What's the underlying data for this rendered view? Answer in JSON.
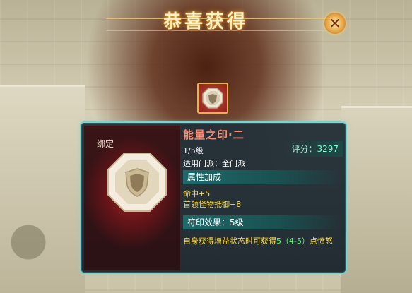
{
  "header": {
    "title": "恭喜获得",
    "close_icon": "close-x-icon"
  },
  "reward": {
    "icon": "octagon-shield-gem-icon"
  },
  "item": {
    "bind_tag": "绑定",
    "name": "能量之印·二",
    "level": "1/5级",
    "school": "适用门派：全门派",
    "score_label": "评分：",
    "score_value": "3297",
    "attr_header": "属性加成",
    "attrs": [
      "命中+5",
      "首领怪物抵御+8"
    ],
    "effect_header": "符印效果：5级",
    "effect_desc_pre": "自身获得增益状态时可获得",
    "effect_desc_num": "5（4-5）",
    "effect_desc_post": "点愤怒"
  },
  "colors": {
    "name": "#ff8c72",
    "attr": "#ffdc3c",
    "highlight": "#54ff6a",
    "border": "#7fd0cf"
  }
}
